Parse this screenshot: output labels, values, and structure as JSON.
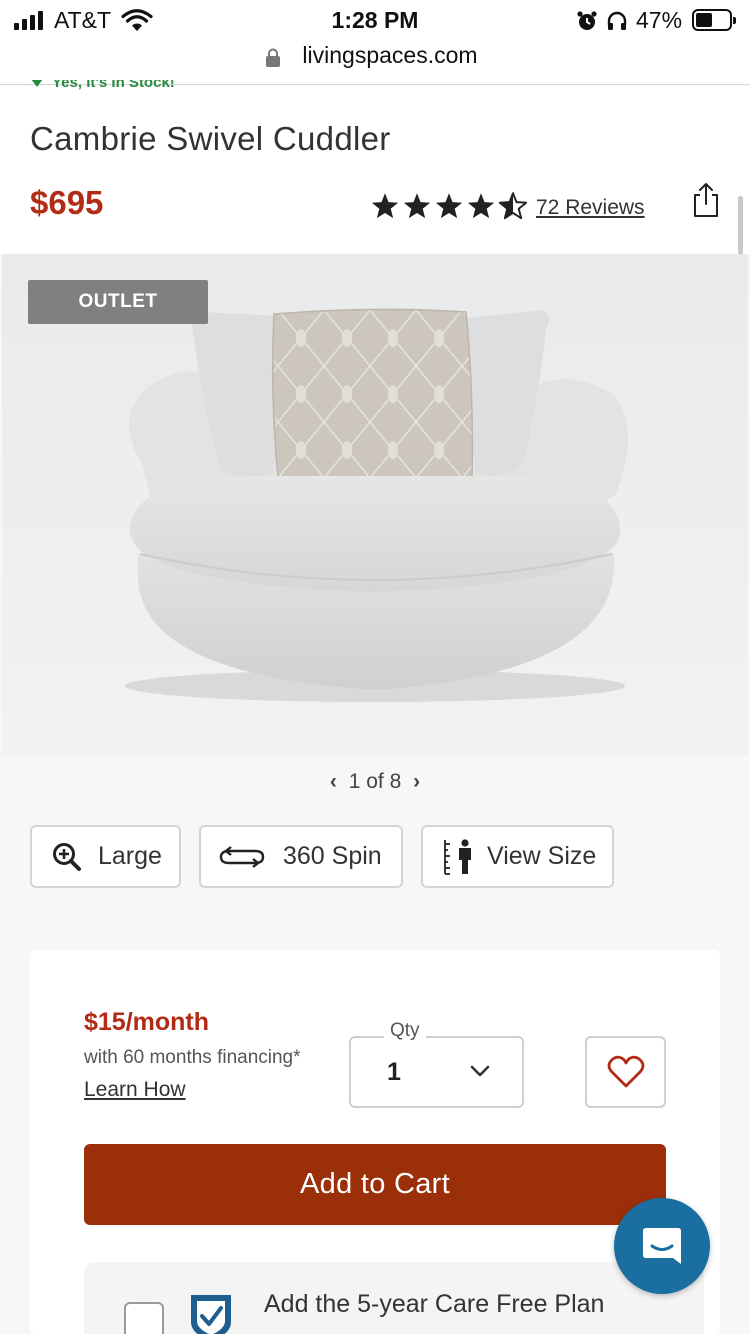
{
  "status_bar": {
    "carrier": "AT&T",
    "time": "1:28 PM",
    "battery_percent": "47%",
    "battery_level": 0.47,
    "icons": [
      "signal-icon",
      "wifi-icon",
      "alarm-icon",
      "headphones-icon",
      "battery-icon"
    ]
  },
  "browser": {
    "url": "livingspaces.com"
  },
  "product": {
    "stock_text": "Yes, it's In Stock!",
    "title": "Cambrie Swivel Cuddler",
    "price": "$695",
    "rating": 4.5,
    "reviews_label": "72 Reviews"
  },
  "gallery": {
    "badge": "OUTLET",
    "pager": "1 of 8"
  },
  "tools": {
    "large_label": "Large",
    "spin_label": "360 Spin",
    "view_size_label": "View Size"
  },
  "purchase": {
    "monthly_price": "$15/month",
    "financing_text": "with 60 months financing*",
    "learn_how": "Learn How",
    "qty_label": "Qty",
    "qty_value": "1",
    "add_to_cart": "Add to Cart",
    "care_plan_text": "Add the 5-year Care Free Plan"
  },
  "colors": {
    "price_red": "#b22b16",
    "cart_button": "#9a2f0a",
    "chat_blue": "#1a6fa0",
    "stock_green": "#2b8a3e",
    "outlet_badge": "#808080"
  }
}
